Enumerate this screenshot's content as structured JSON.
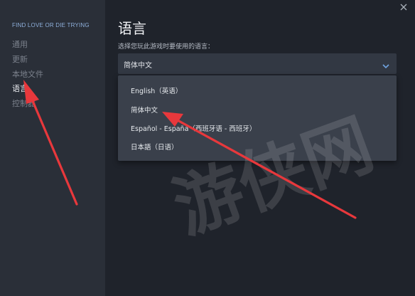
{
  "sidebar": {
    "game_title": "FIND LOVE OR DIE TRYING",
    "items": [
      {
        "label": "通用"
      },
      {
        "label": "更新"
      },
      {
        "label": "本地文件"
      },
      {
        "label": "语言"
      },
      {
        "label": "控制器"
      }
    ],
    "active_item": "语言"
  },
  "main": {
    "title": "语言",
    "field_label": "选择您玩此游戏时要使用的语言：",
    "select": {
      "value": "简体中文",
      "icon": "chevron-down-icon"
    },
    "options": [
      {
        "label": "English（英语）"
      },
      {
        "label": "简体中文"
      },
      {
        "label": "Español - España（西班牙语 - 西班牙）"
      },
      {
        "label": "日本語（日语）"
      }
    ]
  },
  "window": {
    "close_icon": "close-icon"
  },
  "watermark": "游侠网",
  "colors": {
    "background": "#1f232b",
    "sidebar": "#2a2f38",
    "accent": "#8fb0dc",
    "arrow": "#e8383c",
    "dropdown": "#3a404b"
  }
}
